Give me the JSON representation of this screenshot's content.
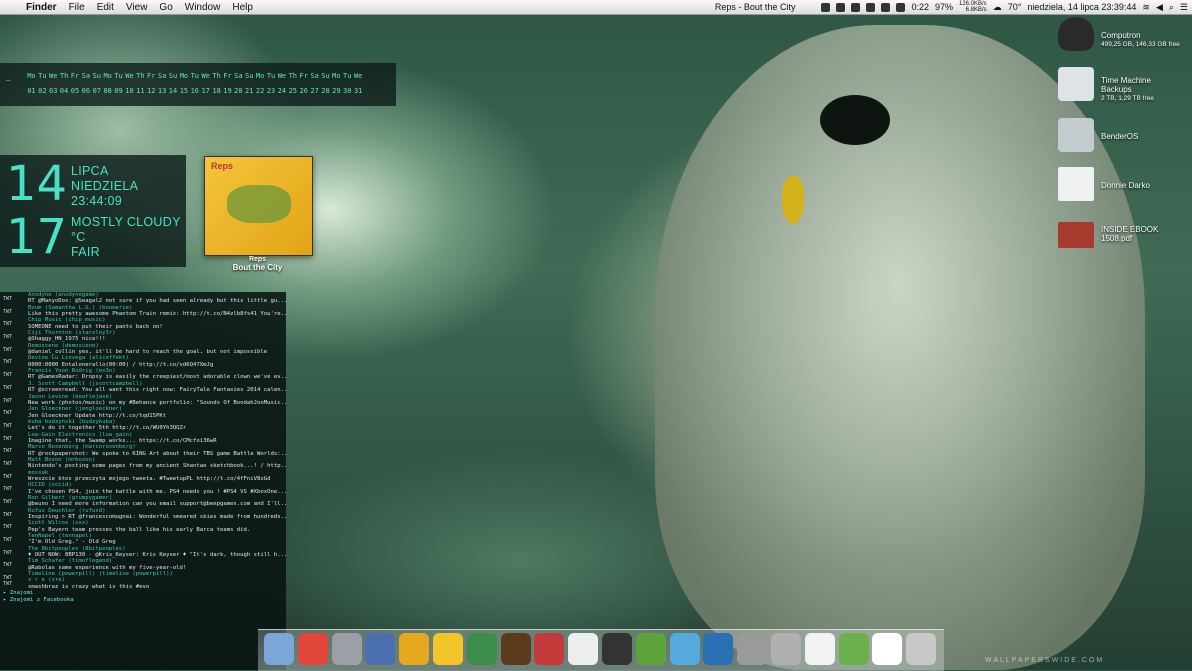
{
  "menubar": {
    "apple": "",
    "items": [
      "Finder",
      "File",
      "Edit",
      "View",
      "Go",
      "Window",
      "Help"
    ],
    "now_playing": "Reps - Bout the City",
    "cpu": "0:22",
    "battery": "97%",
    "net_up": "126.0KB/s",
    "net_down": "6.8KB/s",
    "temp": "70°",
    "datetime": "niedziela, 14 lipca  23:39:44"
  },
  "calendar": {
    "dash": "—",
    "days": [
      "Mo",
      "Tu",
      "We",
      "Th",
      "Fr",
      "Sa",
      "Su",
      "Mo",
      "Tu",
      "We",
      "Th",
      "Fr",
      "Sa",
      "Su",
      "Mo",
      "Tu",
      "We",
      "Th",
      "Fr",
      "Sa",
      "Su",
      "Mo",
      "Tu",
      "We",
      "Th",
      "Fr",
      "Sa",
      "Su",
      "Mo",
      "Tu",
      "We"
    ],
    "nums": [
      "01",
      "02",
      "03",
      "04",
      "05",
      "06",
      "07",
      "08",
      "09",
      "10",
      "11",
      "12",
      "13",
      "14",
      "15",
      "16",
      "17",
      "18",
      "19",
      "20",
      "21",
      "22",
      "23",
      "24",
      "25",
      "26",
      "27",
      "28",
      "29",
      "30",
      "31"
    ]
  },
  "clock": {
    "day": "14",
    "month": "LIPCA",
    "weekday": "NIEDZIELA",
    "time": "23:44:09",
    "temp": "17",
    "condition": "MOSTLY CLOUDY",
    "unit": "°C",
    "forecast": "FAIR"
  },
  "album": {
    "cover_text": "Reps",
    "artist": "Reps",
    "title": "Bout the City"
  },
  "feed": {
    "label": "TWT",
    "entries": [
      {
        "user": "Anodyne (anodynegame)",
        "msg": "RT @ManyoDos: @Seagal2 not sure if you had seen already but this little gu..."
      },
      {
        "user": "Boum (Samantha L.G.) (boumerie)",
        "msg": "Like this pretty awesome Phantom Train remix: http://t.co/N4zlb8fs41 You're..."
      },
      {
        "user": "Chip Music (chip_music)",
        "msg": "SOMEONE need to put their pants back on!"
      },
      {
        "user": "Ciji Thornton (starsloy3r)",
        "msg": "@Shaggy_HN_1975 nice!!!"
      },
      {
        "user": "Demoscene (demoscene)",
        "msg": "@daniel_collin yes, it'll be hard to reach the goal, but not impossible"
      },
      {
        "user": "Devine Lu Linvega (aliceffekt)",
        "msg": "0000:0000 Entalonerallo(00:00) / http://t.co/vd6Q47XmJg"
      },
      {
        "user": "Francis Yoon Rodrig (ex3n)",
        "msg": "RT @GamesRadar: Dropsy is easily the creepiest/most adorable clown we've ev..."
      },
      {
        "user": "J. Scott Campbell (jscottcampbell)",
        "msg": "RT @screenread: You all want this right now: FairyTale Fantasies 2014 calen..."
      },
      {
        "user": "Jason Levine (beatlejase)",
        "msg": "New work (photos/music) on my #Behance portfolio: \"Sounds Of BoodahJooMusic..."
      },
      {
        "user": "Jen Gloeckner (jengloeckner)",
        "msg": "Jen Gloeckner Update http://t.co/tqd15PKt"
      },
      {
        "user": "kuba budzynski (budzykuba)",
        "msg": "Let's do it together 5th http://t.co/WU0Yh3QQZr"
      },
      {
        "user": "Low-Gain Electronics (low_gain)",
        "msg": "Imagine that, the Swamp works... https://t.co/CMcfoi36wR"
      },
      {
        "user": "Marco Rosenberg (marcorosenberg)",
        "msg": "RT @rockpapershot: We spoke to KING Art about their TBS game Battle Worlds:..."
      },
      {
        "user": "Matt Bozon (mrbozon)",
        "msg": "Nintendo's posting some pages from my ancient Shantae sketchbook...! / http..."
      },
      {
        "user": "mossak",
        "msg": "Wreszcie ktos przeczyta mojego tweeta. #TweetupPL http://t.co/4fFniV8xGd"
      },
      {
        "user": "OCCID (occid)",
        "msg": "I've chosen PS4, join the battle with me. PS4 needs you ! #PS4 VS #XboxOne..."
      },
      {
        "user": "Ron Gilbert (grumpygamer)",
        "msg": "@beuno I need more information can you email support@beepgames.com and I'll..."
      },
      {
        "user": "Rufus Deuchler (rufusd)",
        "msg": "Inspiring > RT @francescomugnai: Wonderful smeared skies made from hundreds..."
      },
      {
        "user": "Scott Wilcox (sxx)",
        "msg": "Pep's Bayern team presses the ball like his early Barca teams did."
      },
      {
        "user": "TenNapel (tennapel)",
        "msg": "\"I'm Old Greg.\" - Old Greg"
      },
      {
        "user": "The 8bitpeoples (8bitpeoples)",
        "msg": "♦ OUT NOW: 8BP130 - @Kris_Keyser: Kris Keyser ♦ \"It's dark, though still h..."
      },
      {
        "user": "Tim Schafer (timoflegend)",
        "msg": "@Rabolas same experience with my five-year-old!"
      },
      {
        "user": "Timeline (powerpill) (timeline (powerpill))",
        "msg": ""
      },
      {
        "user": "x r e (xre)",
        "msg": "smashbraz is crazy what is this #evo"
      }
    ],
    "footer": [
      "Znajomi",
      "Znajomi z Facebooka"
    ]
  },
  "desktop_icons": [
    {
      "name": "Computron",
      "sub": "499,25 GB, 146,33 GB free",
      "color": "#2a2a2a"
    },
    {
      "name": "Time Machine",
      "name2": "Backups",
      "sub": "2 TB, 1,29 TB free",
      "color": "#dde3e6"
    },
    {
      "name": "BenderOS",
      "sub": "",
      "color": "#c4ccd0"
    },
    {
      "name": "Donnie Darko",
      "sub": "",
      "color": "#eef0f2"
    },
    {
      "name": "INSIDE EBOOK",
      "name2": "1508.pdf",
      "sub": "",
      "color": "#a53b2a"
    }
  ],
  "dock": {
    "items": [
      "Finder",
      "Chrome",
      "Totoro",
      "Pencil",
      "Pencil 2",
      "Emoji",
      "Frog",
      "Game",
      "Flag",
      "Scroll",
      "Disc",
      "Green",
      "Monitor",
      "Cassette",
      "Gear",
      "Safe",
      "Folder",
      "Evernote",
      "Document",
      "Trash"
    ],
    "colors": [
      "#7aa6d8",
      "#e2453a",
      "#9aa0a6",
      "#4c6fb0",
      "#e5a81f",
      "#f2c428",
      "#3b8e4a",
      "#5c3a1c",
      "#c23a3a",
      "#eeeeee",
      "#333333",
      "#5ca43a",
      "#55aadd",
      "#2a6fb3",
      "#9a9a9a",
      "#b0b0b0",
      "#f2f2f2",
      "#6ab04c",
      "#ffffff",
      "#c8c8c8"
    ]
  },
  "watermark": "WALLPAPERSWIDE.COM"
}
